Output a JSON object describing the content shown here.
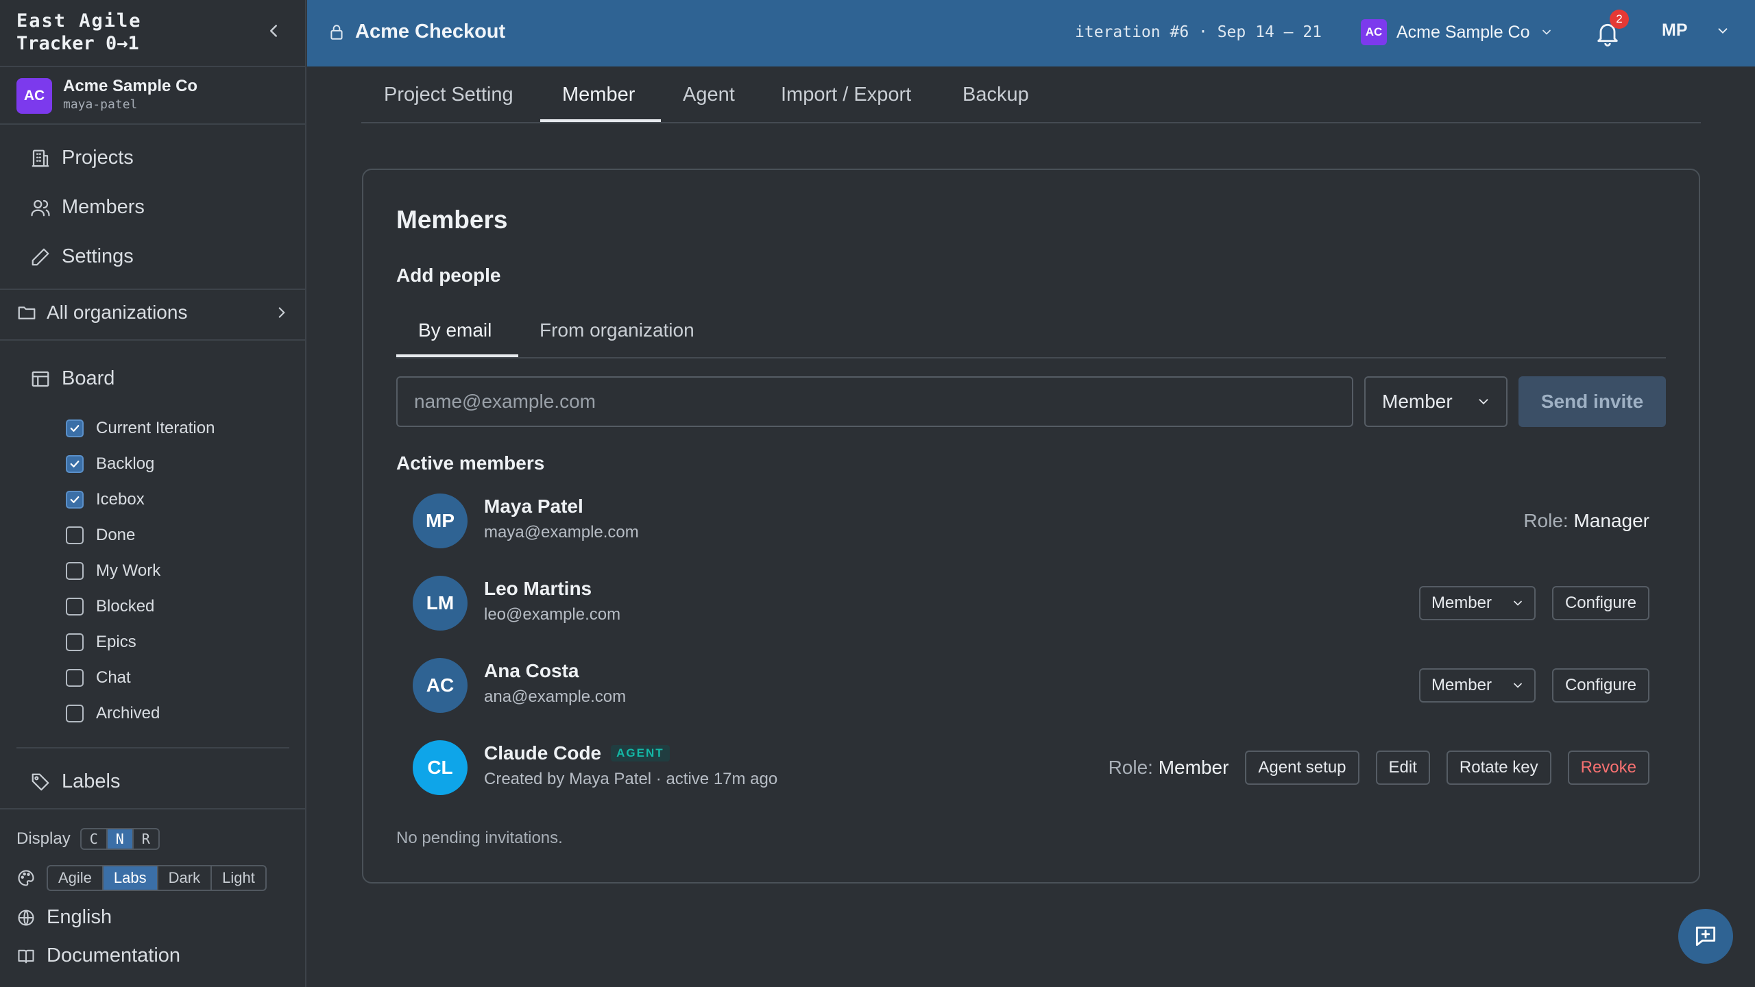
{
  "brand": {
    "line1": "East Agile",
    "line2": "Tracker 0→1"
  },
  "org": {
    "initials": "AC",
    "name": "Acme Sample Co",
    "user": "maya-patel"
  },
  "nav": {
    "projects": "Projects",
    "members": "Members",
    "settings": "Settings"
  },
  "all_orgs": "All organizations",
  "board": {
    "title": "Board",
    "items": [
      {
        "label": "Current Iteration",
        "checked": true
      },
      {
        "label": "Backlog",
        "checked": true
      },
      {
        "label": "Icebox",
        "checked": true
      },
      {
        "label": "Done",
        "checked": false
      },
      {
        "label": "My Work",
        "checked": false
      },
      {
        "label": "Blocked",
        "checked": false
      },
      {
        "label": "Epics",
        "checked": false
      },
      {
        "label": "Chat",
        "checked": false
      },
      {
        "label": "Archived",
        "checked": false
      }
    ]
  },
  "labels": "Labels",
  "display": {
    "label": "Display",
    "options": [
      "C",
      "N",
      "R"
    ],
    "active": "N"
  },
  "theme": {
    "options": [
      "Agile",
      "Labs",
      "Dark",
      "Light"
    ],
    "active": "Labs"
  },
  "footer": {
    "language": "English",
    "docs": "Documentation"
  },
  "header": {
    "project": "Acme Checkout",
    "iteration": "iteration #6 · Sep 14 – 21",
    "org_initials": "AC",
    "org_name": "Acme Sample Co",
    "notifications": "2",
    "user_initials": "MP"
  },
  "tabs": [
    "Project Setting",
    "Member",
    "Agent",
    "Import / Export",
    "Backup"
  ],
  "active_tab": "Member",
  "members_page": {
    "title": "Members",
    "add_people": "Add people",
    "subtabs": [
      "By email",
      "From organization"
    ],
    "email_placeholder": "name@example.com",
    "role_default": "Member",
    "send_label": "Send invite",
    "active_title": "Active members",
    "role_prefix": "Role:",
    "configure": "Configure",
    "agent_tag": "AGENT",
    "agent_setup": "Agent setup",
    "edit": "Edit",
    "rotate_key": "Rotate key",
    "revoke": "Revoke",
    "pending": "No pending invitations."
  },
  "members": [
    {
      "initials": "MP",
      "name": "Maya Patel",
      "email": "maya@example.com",
      "role": "Manager"
    },
    {
      "initials": "LM",
      "name": "Leo Martins",
      "email": "leo@example.com",
      "role": "Member"
    },
    {
      "initials": "AC",
      "name": "Ana Costa",
      "email": "ana@example.com",
      "role": "Member"
    },
    {
      "initials": "CL",
      "name": "Claude Code",
      "sub": "Created by Maya Patel · active 17m ago",
      "role": "Member"
    }
  ]
}
